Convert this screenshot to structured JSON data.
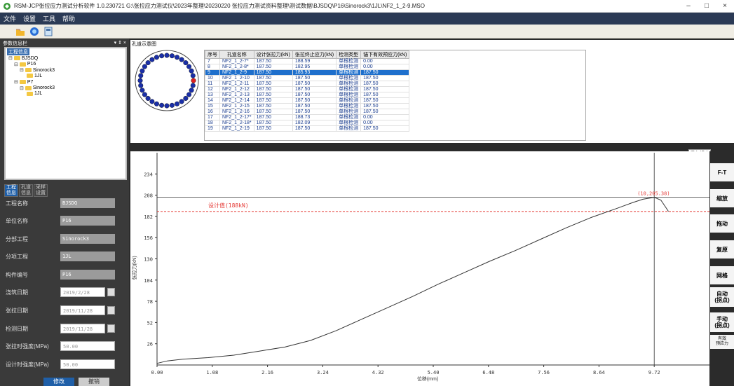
{
  "window": {
    "title": "RSM-JCP张拉应力测试分析软件 1.0.230721  G:\\张拉应力测试仪\\2023年整理\\20230220 张拉应力测试资料整理\\测试数据\\BJSDQ\\P16\\Sinorock3\\1JL\\NF2_1_2-9.MSO",
    "minimize": "–",
    "maximize": "□",
    "close": "×"
  },
  "menu": [
    "文件",
    "设置",
    "工具",
    "帮助"
  ],
  "left": {
    "header": "参数信息栏",
    "header_controls": "▾ ⇕ ×",
    "tree_root": "工程信息",
    "tree": [
      {
        "label": "BJSDQ",
        "level": 0,
        "exp": "⊟"
      },
      {
        "label": "P16",
        "level": 1,
        "exp": "⊟"
      },
      {
        "label": "Sinorock3",
        "level": 2,
        "exp": "⊟"
      },
      {
        "label": "1JL",
        "level": 3,
        "exp": ""
      },
      {
        "label": "P7",
        "level": 1,
        "exp": "⊟"
      },
      {
        "label": "Sinorock3",
        "level": 2,
        "exp": "⊟"
      },
      {
        "label": "1JL",
        "level": 3,
        "exp": ""
      }
    ],
    "tabs": [
      "工程\n信息",
      "孔道\n信息",
      "采样\n设置"
    ],
    "fields": [
      {
        "label": "工程名称",
        "value": "BJSDQ",
        "kind": "gray"
      },
      {
        "label": "单位名称",
        "value": "P16",
        "kind": "gray"
      },
      {
        "label": "分部工程",
        "value": "Sinorock3",
        "kind": "gray"
      },
      {
        "label": "分项工程",
        "value": "1JL",
        "kind": "gray"
      },
      {
        "label": "构件编号",
        "value": "P16",
        "kind": "gray"
      },
      {
        "label": "浇筑日期",
        "value": "2019/2/28",
        "kind": "date"
      },
      {
        "label": "张拉日期",
        "value": "2019/11/28",
        "kind": "date"
      },
      {
        "label": "检测日期",
        "value": "2019/11/28",
        "kind": "date"
      },
      {
        "label": "张拉时强度(MPa)",
        "value": "50.00",
        "kind": "white"
      },
      {
        "label": "设计时强度(MPa)",
        "value": "50.00",
        "kind": "white"
      }
    ],
    "btn_modify": "修改",
    "btn_cancel": "撤销"
  },
  "holes": {
    "header": "孔道示意图",
    "columns": [
      "序号",
      "孔道名称",
      "设计张拉力(kN)",
      "张拉终止应力(kN)",
      "检测类型",
      "锚下有效预应力(kN)"
    ],
    "rows": [
      [
        "7",
        "NF2_1_2-7*",
        "187.50",
        "188.59",
        "单根检测",
        "0.00"
      ],
      [
        "8",
        "NF2_1_2-8*",
        "187.50",
        "182.95",
        "单根检测",
        "0.00"
      ],
      [
        "9",
        "NF2_1_2-9",
        "187.50",
        "185.93",
        "单根检测",
        "187.50"
      ],
      [
        "10",
        "NF2_1_2-10",
        "187.50",
        "187.50",
        "单根检测",
        "187.50"
      ],
      [
        "11",
        "NF2_1_2-11",
        "187.50",
        "187.50",
        "单根检测",
        "187.50"
      ],
      [
        "12",
        "NF2_1_2-12",
        "187.50",
        "187.50",
        "单根检测",
        "187.50"
      ],
      [
        "13",
        "NF2_1_2-13",
        "187.50",
        "187.50",
        "单根检测",
        "187.50"
      ],
      [
        "14",
        "NF2_1_2-14",
        "187.50",
        "187.50",
        "单根检测",
        "187.50"
      ],
      [
        "15",
        "NF2_1_2-15",
        "187.50",
        "187.50",
        "单根检测",
        "187.50"
      ],
      [
        "16",
        "NF2_1_2-16",
        "187.50",
        "187.50",
        "单根检测",
        "187.50"
      ],
      [
        "17",
        "NF2_1_2-17*",
        "187.50",
        "188.73",
        "单根检测",
        "0.00"
      ],
      [
        "18",
        "NF2_1_2-18*",
        "187.50",
        "182.09",
        "单根检测",
        "0.00"
      ],
      [
        "19",
        "NF2_1_2-19",
        "187.50",
        "187.50",
        "单根检测",
        "187.50"
      ]
    ],
    "selected_index": 2,
    "dot_color": "#1a2fa8",
    "selected_dot_color": "#e02020"
  },
  "save_button": "保存拐点",
  "chart_data": {
    "type": "line",
    "xlabel": "位移(mm)",
    "ylabel": "张拉力(kN)",
    "xticks": [
      "0.00",
      "1.08",
      "2.16",
      "3.24",
      "4.32",
      "5.40",
      "6.48",
      "7.56",
      "8.64",
      "9.72"
    ],
    "yticks": [
      "26",
      "52",
      "78",
      "104",
      "130",
      "156",
      "182",
      "208",
      "234"
    ],
    "xlim": [
      0,
      10.8
    ],
    "ylim": [
      0,
      260
    ],
    "design_label": "设计值(188kN)",
    "design_value": 188,
    "peak_label": "(10,205.38)",
    "peak": [
      9.72,
      205.38
    ],
    "series": [
      {
        "x": [
          0,
          0.2,
          0.5,
          1.0,
          1.5,
          2.0,
          2.5,
          3.0,
          3.5,
          4.0,
          4.5,
          5.0,
          5.5,
          6.0,
          6.5,
          7.0,
          7.5,
          8.0,
          8.5,
          9.0,
          9.3,
          9.5,
          9.72,
          9.85,
          10.0
        ],
        "y": [
          2,
          5,
          7,
          9,
          12,
          17,
          22,
          30,
          42,
          56,
          70,
          84,
          99,
          113,
          127,
          140,
          154,
          168,
          181,
          192,
          199,
          203,
          205.38,
          202,
          188
        ]
      }
    ],
    "grid": false,
    "line_color": "#333333",
    "design_color": "#e53935"
  },
  "right_buttons": [
    "F-T",
    "缩放",
    "拖动",
    "复原",
    "网格",
    "自动\n(拐点)",
    "手动\n(拐点)",
    "有效\n预应力"
  ]
}
